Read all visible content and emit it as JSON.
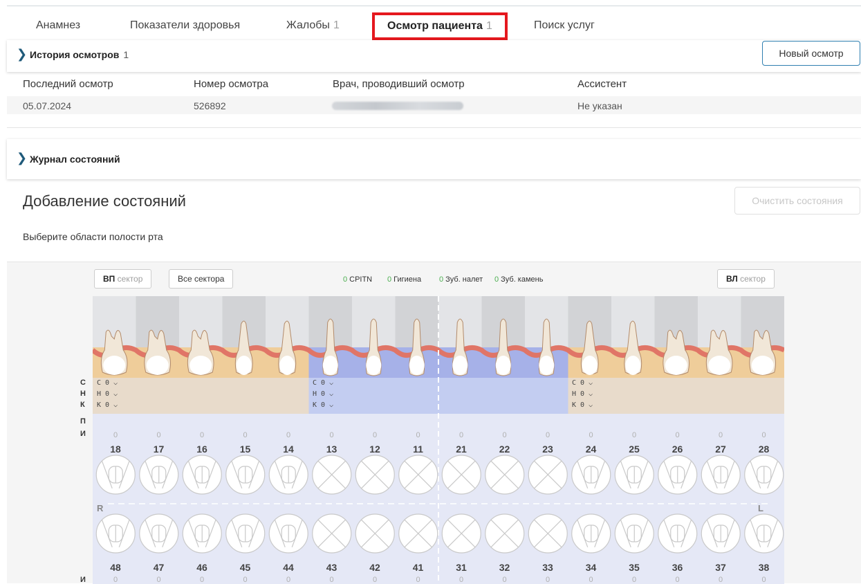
{
  "tabs": [
    {
      "label": "Анамнез",
      "count": ""
    },
    {
      "label": "Показатели здоровья",
      "count": ""
    },
    {
      "label": "Жалобы",
      "count": "1"
    },
    {
      "label": "Осмотр пациента",
      "count": "1",
      "active": true
    },
    {
      "label": "Поиск услуг",
      "count": ""
    }
  ],
  "history": {
    "title": "История осмотров",
    "count": "1",
    "new_button": "Новый осмотр",
    "columns": [
      "Последний осмотр",
      "Номер осмотра",
      "Врач, проводивший осмотр",
      "Ассистент"
    ],
    "row": {
      "date": "05.07.2024",
      "number": "526892",
      "assistant": "Не указан"
    }
  },
  "journal": {
    "title": "Журнал состояний"
  },
  "conditions": {
    "title": "Добавление состояний",
    "clear_button": "Очистить состояния",
    "hint": "Выберите области полости рта"
  },
  "chart": {
    "btn_vp_bold": "ВП",
    "btn_vp_rest": "сектор",
    "btn_all": "Все сектора",
    "btn_vl_bold": "ВЛ",
    "btn_vl_rest": "сектор",
    "legend": [
      {
        "n": "0",
        "label": "CPITN"
      },
      {
        "n": "0",
        "label": "Гигиена"
      },
      {
        "n": "0",
        "label": "Зуб. налет"
      },
      {
        "n": "0",
        "label": "Зуб. камень"
      }
    ],
    "row_labels": [
      "С",
      "Н",
      "К",
      "П",
      "И"
    ],
    "lower_label": "И",
    "sector_values": [
      "С 0",
      "Н 0",
      "К 0"
    ],
    "zero": "0",
    "upper_teeth": [
      "18",
      "17",
      "16",
      "15",
      "14",
      "13",
      "12",
      "11",
      "21",
      "22",
      "23",
      "24",
      "25",
      "26",
      "27",
      "28"
    ],
    "lower_teeth": [
      "48",
      "47",
      "46",
      "45",
      "44",
      "43",
      "42",
      "41",
      "31",
      "32",
      "33",
      "34",
      "35",
      "36",
      "37",
      "38"
    ],
    "side_right": "R",
    "side_left": "L",
    "colors": {
      "gum": "#e07567",
      "base_beige": "#efcd9a",
      "base_blue": "#a6b1e8",
      "sector_beige": "#e8dbcb",
      "sector_blue": "#c3cdf1",
      "teeth_bg": "#e5e8f6",
      "accent": "#2f7fb0",
      "highlight": "#e5181e"
    }
  }
}
